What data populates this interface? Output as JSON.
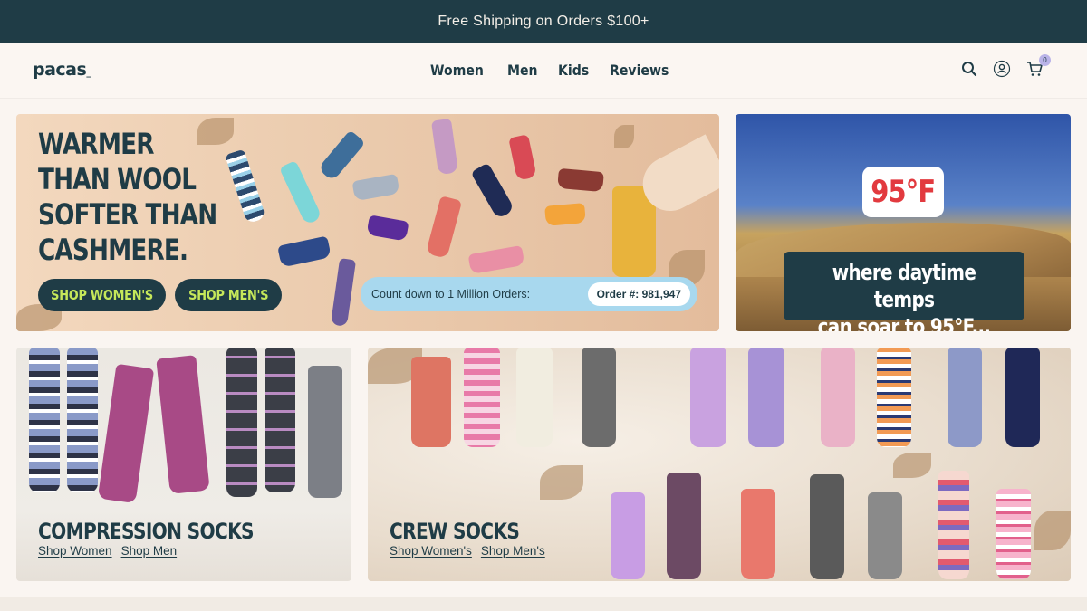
{
  "announcement": "Free Shipping on Orders $100+",
  "header": {
    "logo": "pacas",
    "nav": [
      "Women",
      "Men",
      "Kids",
      "Reviews"
    ],
    "icons": [
      "search-icon",
      "account-icon",
      "cart-icon"
    ],
    "cart_count": "0"
  },
  "hero": {
    "title": "WARMER\nTHAN WOOL\nSOFTER THAN\nCASHMERE.",
    "shop_women": "SHOP WOMEN'S",
    "shop_men": "SHOP MEN'S",
    "counter_label": "Count down to 1 Million Orders:",
    "order_number": "Order #: 981,947"
  },
  "promo": {
    "temp_badge": "95°F",
    "caption": "where daytime temps\ncan soar to 95°F..."
  },
  "compression": {
    "title": "COMPRESSION SOCKS",
    "link_women": "Shop Women",
    "link_men": "Shop Men"
  },
  "crew": {
    "title": "CREW SOCKS",
    "link_women": "Shop Women's",
    "link_men": "Shop Men's"
  },
  "colors": {
    "brand_dark": "#1f3c46",
    "button_text": "#c6e85a",
    "temp_red": "#e23a3f"
  }
}
